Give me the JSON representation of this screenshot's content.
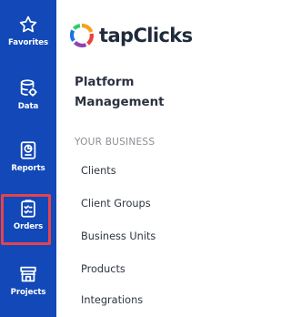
{
  "rail": {
    "items": [
      {
        "label": "Favorites",
        "icon": "star-icon"
      },
      {
        "label": "Data",
        "icon": "database-icon"
      },
      {
        "label": "Reports",
        "icon": "report-icon"
      },
      {
        "label": "Orders",
        "icon": "clipboard-check-icon",
        "highlighted": true
      },
      {
        "label": "Projects",
        "icon": "storefront-icon"
      }
    ],
    "background": "#1248b8",
    "highlight_color": "#e5434b"
  },
  "brand": {
    "name": "tapClicks",
    "logo_icon": "tapclicks-ring-logo"
  },
  "panel": {
    "title": "Platform Management",
    "subtitle": "YOUR BUSINESS",
    "items": [
      "Clients",
      "Client Groups",
      "Business Units",
      "Products",
      "Integrations"
    ]
  }
}
